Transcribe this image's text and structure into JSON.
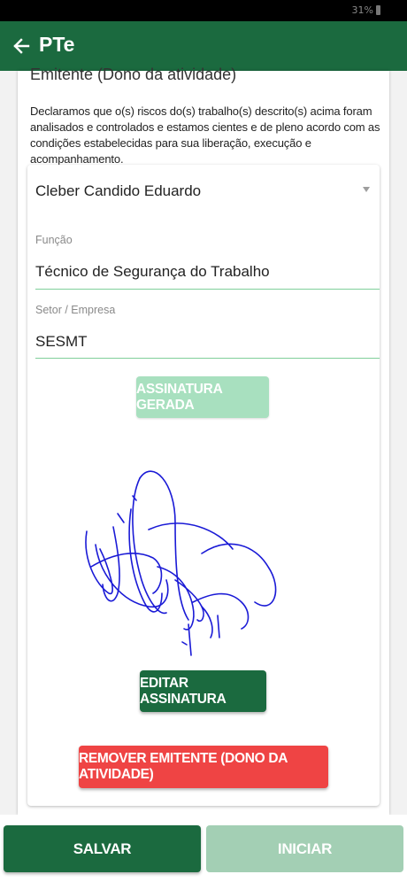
{
  "status_bar": {
    "battery_text": "31%"
  },
  "app_bar": {
    "title": "PTe",
    "back_icon": "arrow-left-icon"
  },
  "section": {
    "title": "Emitente (Dono da atividade)",
    "declaration": "Declaramos que o(s) riscos do(s) trabalho(s) descrito(s) acima foram analisados e controlados e estamos cientes e de pleno acordo com as condições estabelecidas para sua liberação, execução e acompanhamento."
  },
  "emitter": {
    "name": "Cleber Candido Eduardo",
    "funcao_label": "Função",
    "funcao_value": "Técnico de Segurança do Trabalho",
    "setor_label": "Setor / Empresa",
    "setor_value": "SESMT"
  },
  "buttons": {
    "signature_generated": "ASSINATURA GERADA",
    "edit_signature": "EDITAR ASSINATURA",
    "remove_emitter": "REMOVER EMITENTE (DONO DA ATIVIDADE)",
    "save": "SALVAR",
    "start": "INICIAR"
  },
  "colors": {
    "primary": "#1b6a3f",
    "primary_disabled": "#a8e0bf",
    "danger": "#ef4444",
    "signature_ink": "#1a1ad6"
  }
}
